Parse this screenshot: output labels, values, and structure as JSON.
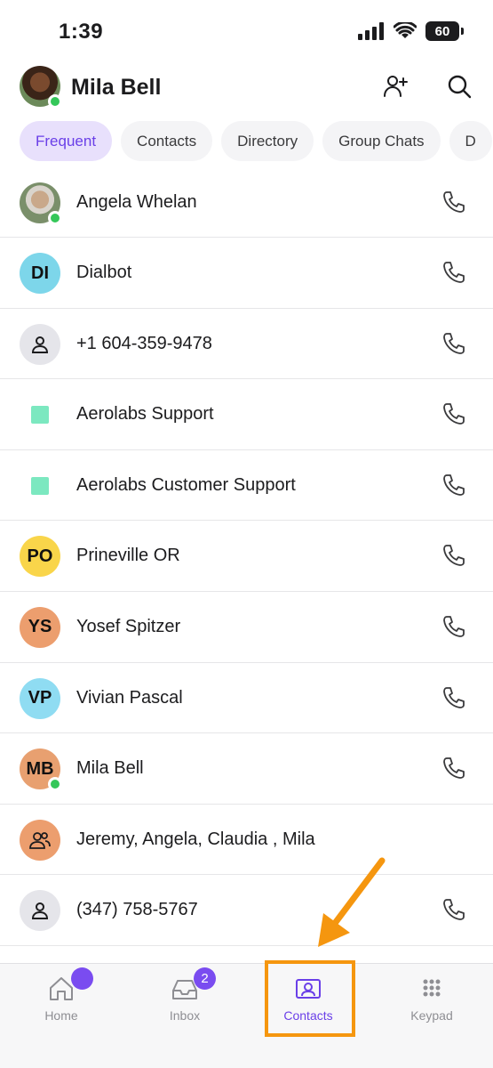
{
  "status_bar": {
    "time": "1:39",
    "battery": "60"
  },
  "header": {
    "user_name": "Mila Bell"
  },
  "tabs": [
    {
      "label": "Frequent",
      "active": true
    },
    {
      "label": "Contacts",
      "active": false
    },
    {
      "label": "Directory",
      "active": false
    },
    {
      "label": "Group Chats",
      "active": false
    },
    {
      "label": "D",
      "active": false
    }
  ],
  "contacts": [
    {
      "name": "Angela Whelan",
      "avatar": "photo",
      "online": true,
      "call": true
    },
    {
      "name": "Dialbot",
      "initials": "DI",
      "color": "#7dd6ea",
      "call": true
    },
    {
      "name": "+1 604-359-9478",
      "avatar": "person-icon",
      "call": true
    },
    {
      "name": "Aerolabs Support",
      "avatar": "square",
      "call": true
    },
    {
      "name": "Aerolabs Customer Support",
      "avatar": "square",
      "call": true
    },
    {
      "name": "Prineville OR",
      "initials": "PO",
      "color": "#f9d54a",
      "call": true
    },
    {
      "name": "Yosef Spitzer",
      "initials": "YS",
      "color": "#ec9e6e",
      "call": true
    },
    {
      "name": "Vivian Pascal",
      "initials": "VP",
      "color": "#8fdcf2",
      "call": true
    },
    {
      "name": "Mila Bell",
      "initials": "MB",
      "color": "#e8a070",
      "online": true,
      "call": true
    },
    {
      "name": "Jeremy, Angela, Claudia , Mila",
      "avatar": "group-icon",
      "color": "#ec9e6e",
      "call": false
    },
    {
      "name": "(347) 758-5767",
      "avatar": "person-icon",
      "call": true
    }
  ],
  "tabbar": {
    "home": "Home",
    "inbox": "Inbox",
    "inbox_badge": "2",
    "contacts": "Contacts",
    "keypad": "Keypad"
  },
  "colors": {
    "accent": "#6a3fe8",
    "annotation": "#f5960f",
    "online": "#34c759"
  }
}
